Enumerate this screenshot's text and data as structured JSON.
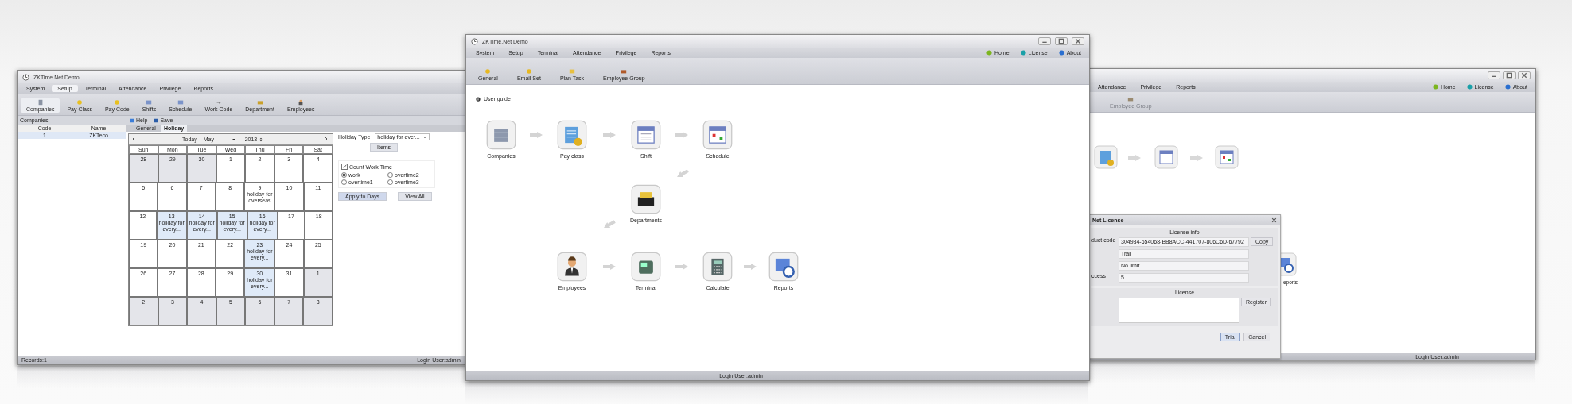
{
  "left_window": {
    "title": "ZKTime.Net Demo",
    "menu": [
      {
        "label": "System",
        "selected": false
      },
      {
        "label": "Setup",
        "selected": true
      },
      {
        "label": "Terminal",
        "selected": false
      },
      {
        "label": "Attendance",
        "selected": false
      },
      {
        "label": "Privilege",
        "selected": false
      },
      {
        "label": "Reports",
        "selected": false
      }
    ],
    "toolbar": [
      {
        "label": "Companies",
        "selected": true
      },
      {
        "label": "Pay Class",
        "selected": false
      },
      {
        "label": "Pay Code",
        "selected": false
      },
      {
        "label": "Shifts",
        "selected": false
      },
      {
        "label": "Schedule",
        "selected": false
      },
      {
        "label": "Work Code",
        "selected": false
      },
      {
        "label": "Department",
        "selected": false
      },
      {
        "label": "Employees",
        "selected": false
      }
    ],
    "companies": {
      "title": "Companies",
      "columns": [
        "Code",
        "Name"
      ],
      "rows": [
        {
          "cells": [
            "1",
            "ZKTeco"
          ],
          "selected": true
        }
      ]
    },
    "actions": [
      "Help",
      "Save"
    ],
    "tabs": [
      {
        "label": "General",
        "selected": false
      },
      {
        "label": "Holiday",
        "selected": true
      }
    ],
    "calendar": {
      "today": "Today",
      "month": "May",
      "year": "2013",
      "weekdays": [
        "Sun",
        "Mon",
        "Tue",
        "Wed",
        "Thu",
        "Fri",
        "Sat"
      ],
      "weeks": [
        [
          {
            "day": "28",
            "other_month": true,
            "holiday": false
          },
          {
            "day": "29",
            "other_month": true,
            "holiday": false
          },
          {
            "day": "30",
            "other_month": true,
            "holiday": false
          },
          {
            "day": "1",
            "other_month": false,
            "holiday": false
          },
          {
            "day": "2",
            "other_month": false,
            "holiday": false
          },
          {
            "day": "3",
            "other_month": false,
            "holiday": false
          },
          {
            "day": "4",
            "other_month": false,
            "holiday": false
          }
        ],
        [
          {
            "day": "5",
            "other_month": false,
            "holiday": false
          },
          {
            "day": "6",
            "other_month": false,
            "holiday": false
          },
          {
            "day": "7",
            "other_month": false,
            "holiday": false
          },
          {
            "day": "8",
            "other_month": false,
            "holiday": false
          },
          {
            "day": "9",
            "other_month": false,
            "holiday": false,
            "note": "holiday for overseas"
          },
          {
            "day": "10",
            "other_month": false,
            "holiday": false
          },
          {
            "day": "11",
            "other_month": false,
            "holiday": false
          }
        ],
        [
          {
            "day": "12",
            "other_month": false,
            "holiday": false
          },
          {
            "day": "13",
            "other_month": false,
            "holiday": true,
            "note": "holiday for every..."
          },
          {
            "day": "14",
            "other_month": false,
            "holiday": true,
            "note": "holiday for every..."
          },
          {
            "day": "15",
            "other_month": false,
            "holiday": true,
            "note": "holiday for every..."
          },
          {
            "day": "16",
            "other_month": false,
            "holiday": true,
            "note": "holiday for every..."
          },
          {
            "day": "17",
            "other_month": false,
            "holiday": false
          },
          {
            "day": "18",
            "other_month": false,
            "holiday": false
          }
        ],
        [
          {
            "day": "19",
            "other_month": false,
            "holiday": false
          },
          {
            "day": "20",
            "other_month": false,
            "holiday": false
          },
          {
            "day": "21",
            "other_month": false,
            "holiday": false
          },
          {
            "day": "22",
            "other_month": false,
            "holiday": false
          },
          {
            "day": "23",
            "other_month": false,
            "holiday": true,
            "note": "holiday for every..."
          },
          {
            "day": "24",
            "other_month": false,
            "holiday": false
          },
          {
            "day": "25",
            "other_month": false,
            "holiday": false
          }
        ],
        [
          {
            "day": "26",
            "other_month": false,
            "holiday": false
          },
          {
            "day": "27",
            "other_month": false,
            "holiday": false
          },
          {
            "day": "28",
            "other_month": false,
            "holiday": false
          },
          {
            "day": "29",
            "other_month": false,
            "holiday": false
          },
          {
            "day": "30",
            "other_month": false,
            "holiday": true,
            "note": "holiday for every..."
          },
          {
            "day": "31",
            "other_month": false,
            "holiday": false
          },
          {
            "day": "1",
            "other_month": true,
            "holiday": false
          }
        ],
        [
          {
            "day": "2",
            "other_month": true,
            "holiday": false
          },
          {
            "day": "3",
            "other_month": true,
            "holiday": false
          },
          {
            "day": "4",
            "other_month": true,
            "holiday": false
          },
          {
            "day": "5",
            "other_month": true,
            "holiday": false
          },
          {
            "day": "6",
            "other_month": true,
            "holiday": false
          },
          {
            "day": "7",
            "other_month": true,
            "holiday": false
          },
          {
            "day": "8",
            "other_month": true,
            "holiday": false
          }
        ]
      ]
    },
    "holiday_type": {
      "label": "Holiday Type",
      "value": "holiday for ever..."
    },
    "items_button": "Items",
    "count_work_time": {
      "label": "Count Work Time",
      "checked": true
    },
    "radios": [
      {
        "label": "work",
        "selected": true
      },
      {
        "label": "overtime2",
        "selected": false
      },
      {
        "label": "overtime1",
        "selected": false
      },
      {
        "label": "overtime3",
        "selected": false
      }
    ],
    "buttons": [
      "Apply to Days",
      "View All"
    ],
    "status": {
      "records": "Records:1",
      "user": "Login User:admin"
    }
  },
  "middle_window": {
    "title": "ZKTime.Net Demo",
    "menu": [
      "System",
      "Setup",
      "Terminal",
      "Attendance",
      "Privilege",
      "Reports"
    ],
    "links": [
      "Home",
      "License",
      "About"
    ],
    "toolbar": [
      "General",
      "Email Set",
      "Plan Task",
      "Employee Group"
    ],
    "guide_title": "User guide",
    "nodes": [
      {
        "label": "Companies"
      },
      {
        "label": "Pay class"
      },
      {
        "label": "Shift"
      },
      {
        "label": "Schedule"
      },
      {
        "label": "Departments"
      },
      {
        "label": "Employees"
      },
      {
        "label": "Terminal"
      },
      {
        "label": "Calculate"
      },
      {
        "label": "Reports"
      }
    ],
    "status_user": "Login User:admin"
  },
  "right_window": {
    "menu": [
      "Attendance",
      "Privilege",
      "Reports"
    ],
    "links": [
      "Home",
      "License",
      "About"
    ],
    "toolbar": [
      {
        "label": "Employee Group",
        "disabled": true
      }
    ],
    "partial_label": "eports",
    "dialog": {
      "title": "Net License",
      "info_title": "License info",
      "rows": [
        {
          "label": "duct code",
          "value": "304934-654068-BB8ACC-441707-806C6D-67792"
        },
        {
          "value": "Trail"
        },
        {
          "value": "No limit"
        },
        {
          "label": "ccess",
          "value": "5"
        }
      ],
      "copy": "Copy",
      "license_title": "License",
      "register": "Register",
      "buttons": [
        {
          "label": "Trial",
          "selected": true
        },
        {
          "label": "Cancel",
          "selected": false
        }
      ]
    },
    "status_user": "Login User:admin"
  }
}
